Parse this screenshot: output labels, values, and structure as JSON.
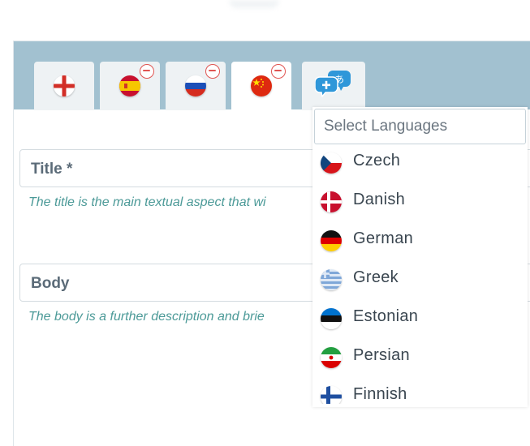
{
  "tabs": [
    {
      "flag": "england-flag-icon",
      "active": false,
      "removable": false
    },
    {
      "flag": "spain-flag-icon",
      "active": false,
      "removable": true
    },
    {
      "flag": "russia-flag-icon",
      "active": false,
      "removable": true
    },
    {
      "flag": "china-flag-icon",
      "active": true,
      "removable": true
    }
  ],
  "add_language_icon": "add-language-icon",
  "fields": {
    "title": {
      "label": "Title *",
      "help": "The title is the main textual aspect that wi"
    },
    "body": {
      "label": "Body",
      "help": "The body is a further description and brie"
    }
  },
  "language_selector": {
    "placeholder": "Select Languages",
    "options": [
      {
        "name": "Czech",
        "flag": "czech-flag-icon"
      },
      {
        "name": "Danish",
        "flag": "danish-flag-icon"
      },
      {
        "name": "German",
        "flag": "german-flag-icon"
      },
      {
        "name": "Greek",
        "flag": "greek-flag-icon"
      },
      {
        "name": "Estonian",
        "flag": "estonian-flag-icon"
      },
      {
        "name": "Persian",
        "flag": "persian-flag-icon"
      },
      {
        "name": "Finnish",
        "flag": "finnish-flag-icon"
      }
    ]
  },
  "colors": {
    "header_bg": "#a2c1d0",
    "help_text": "#4c9a98",
    "remove_badge": "#e05552",
    "add_icon": "#2f97d9"
  }
}
